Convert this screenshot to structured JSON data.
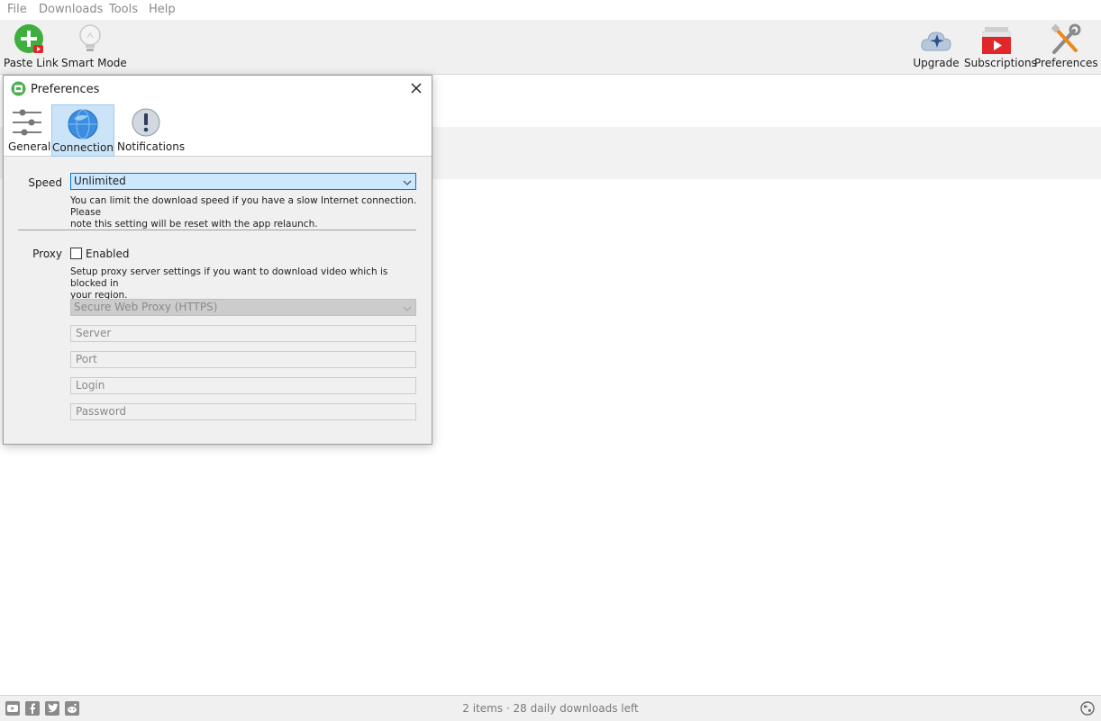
{
  "menu": [
    "File",
    "Downloads",
    "Tools",
    "Help"
  ],
  "toolbar": {
    "paste_link": "Paste Link",
    "smart_mode": "Smart Mode",
    "upgrade": "Upgrade",
    "subscriptions": "Subscriptions",
    "preferences": "Preferences"
  },
  "dialog": {
    "title": "Preferences",
    "tabs": [
      "General",
      "Connection",
      "Notifications"
    ],
    "active_tab": "Connection",
    "speed": {
      "label": "Speed",
      "value": "Unlimited",
      "hint_line1": "You can limit the download speed if you have a slow Internet connection. Please",
      "hint_line2": "note this setting will be reset with the app relaunch."
    },
    "proxy": {
      "label": "Proxy",
      "enabled_label": "Enabled",
      "enabled": false,
      "hint_line1": "Setup proxy server settings if you want to download video which is blocked in",
      "hint_line2": "your region.",
      "type_value": "Secure Web Proxy (HTTPS)",
      "server_placeholder": "Server",
      "port_placeholder": "Port",
      "login_placeholder": "Login",
      "password_placeholder": "Password"
    }
  },
  "status": {
    "text": "2 items · 28 daily downloads left"
  },
  "social_icons": [
    "youtube-icon",
    "facebook-icon",
    "twitter-icon",
    "reddit-icon"
  ],
  "colors": {
    "accent": "#0078d7",
    "selected_tab": "#cce4f7",
    "paste_green": "#3fae3f",
    "subscriptions_red": "#e0262b"
  }
}
